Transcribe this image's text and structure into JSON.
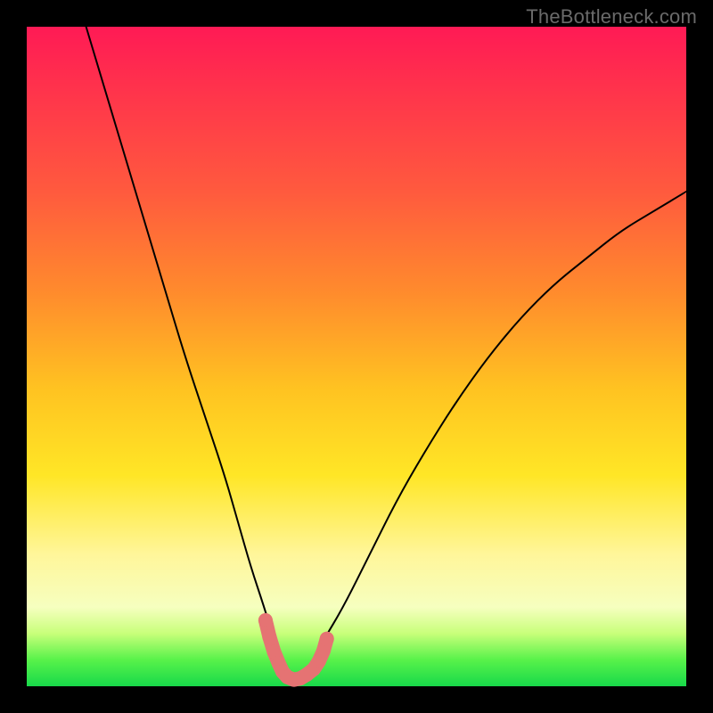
{
  "watermark": {
    "text": "TheBottleneck.com"
  },
  "colors": {
    "curve_stroke": "#000000",
    "marker_fill": "#e57373",
    "marker_stroke": "#e57373"
  },
  "chart_data": {
    "type": "line",
    "title": "",
    "xlabel": "",
    "ylabel": "",
    "xlim": [
      0,
      100
    ],
    "ylim": [
      0,
      100
    ],
    "grid": false,
    "legend": false,
    "series": [
      {
        "name": "bottleneck-curve",
        "x": [
          9,
          12,
          15,
          18,
          21,
          24,
          27,
          30,
          32,
          34,
          36,
          37.5,
          38.5,
          39.2,
          40,
          41,
          42,
          43.5,
          45,
          48,
          52,
          56,
          60,
          65,
          70,
          75,
          80,
          85,
          90,
          95,
          100
        ],
        "y": [
          100,
          90,
          80,
          70,
          60,
          50,
          41,
          32,
          25,
          18,
          12,
          7,
          4,
          2,
          1,
          1,
          2,
          4,
          7,
          12,
          20,
          28,
          35,
          43,
          50,
          56,
          61,
          65,
          69,
          72,
          75
        ]
      }
    ],
    "markers": {
      "name": "highlight-band",
      "x": [
        36.2,
        36.8,
        37.5,
        38.2,
        38.8,
        39.5,
        40.5,
        41.5,
        42.5,
        43.5,
        44.3,
        45.0,
        45.5
      ],
      "y": [
        10,
        7.5,
        5.2,
        3.5,
        2.2,
        1.4,
        1.0,
        1.2,
        1.8,
        2.6,
        3.8,
        5.4,
        7.2
      ]
    }
  }
}
